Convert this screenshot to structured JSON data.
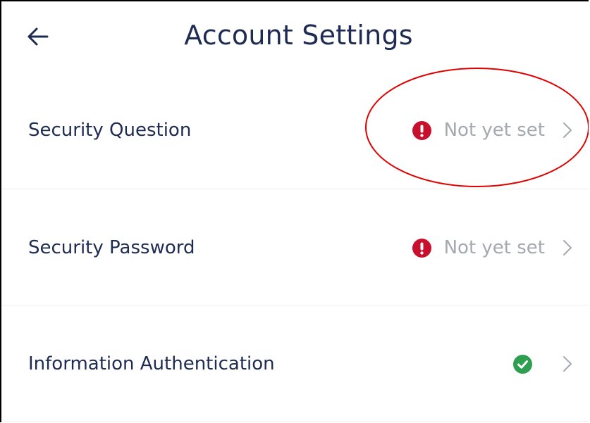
{
  "header": {
    "back_icon": "arrow-left-icon",
    "title": "Account Settings"
  },
  "rows": [
    {
      "label": "Security Question",
      "status_icon": "alert-circle-icon",
      "status_text": "Not yet set",
      "chevron_icon": "chevron-right-icon"
    },
    {
      "label": "Security Password",
      "status_icon": "alert-circle-icon",
      "status_text": "Not yet set",
      "chevron_icon": "chevron-right-icon"
    },
    {
      "label": "Information Authentication",
      "status_icon": "check-circle-icon",
      "status_text": "",
      "chevron_icon": "chevron-right-icon"
    }
  ],
  "colors": {
    "title": "#1e2b52",
    "label": "#1e2b52",
    "status_text": "#a5a8b0",
    "alert": "#c8102e",
    "success": "#2e9e4f",
    "divider": "#eeeeee",
    "annotation_circle": "#e00000"
  }
}
